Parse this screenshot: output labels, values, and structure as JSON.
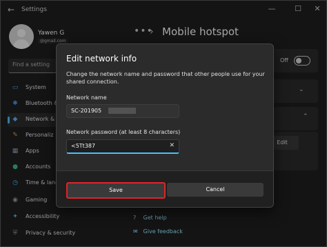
{
  "window": {
    "title": "Settings",
    "back_icon": "←",
    "minimize": "—",
    "maximize": "☐",
    "close": "✕"
  },
  "user": {
    "name": "Yawen G",
    "email": "@gmail.com"
  },
  "search": {
    "placeholder": "Find a setting"
  },
  "sidebar": {
    "items": [
      {
        "label": "System",
        "icon": "▭"
      },
      {
        "label": "Bluetooth &",
        "icon": "✱"
      },
      {
        "label": "Network &",
        "icon": "◆"
      },
      {
        "label": "Personaliz",
        "icon": "✎"
      },
      {
        "label": "Apps",
        "icon": "▦"
      },
      {
        "label": "Accounts",
        "icon": "●"
      },
      {
        "label": "Time & lang",
        "icon": "◷"
      },
      {
        "label": "Gaming",
        "icon": "◉"
      },
      {
        "label": "Accessibility",
        "icon": "✦"
      },
      {
        "label": "Privacy & security",
        "icon": "⛨"
      }
    ]
  },
  "header": {
    "dots": "•••",
    "separator": "›",
    "title": "Mobile hotspot"
  },
  "main": {
    "toggle_label": "Off",
    "edit_label": "Edit",
    "links": [
      {
        "label": "Get help",
        "icon": "?"
      },
      {
        "label": "Give feedback",
        "icon": "✉"
      }
    ]
  },
  "dialog": {
    "title": "Edit network info",
    "description": "Change the network name and password that other people use for your shared connection.",
    "name_label": "Network name",
    "name_value": "SC-201905",
    "password_label": "Network password (at least 8 characters)",
    "password_value": "<5Tt387",
    "clear_icon": "✕",
    "save_label": "Save",
    "cancel_label": "Cancel"
  }
}
